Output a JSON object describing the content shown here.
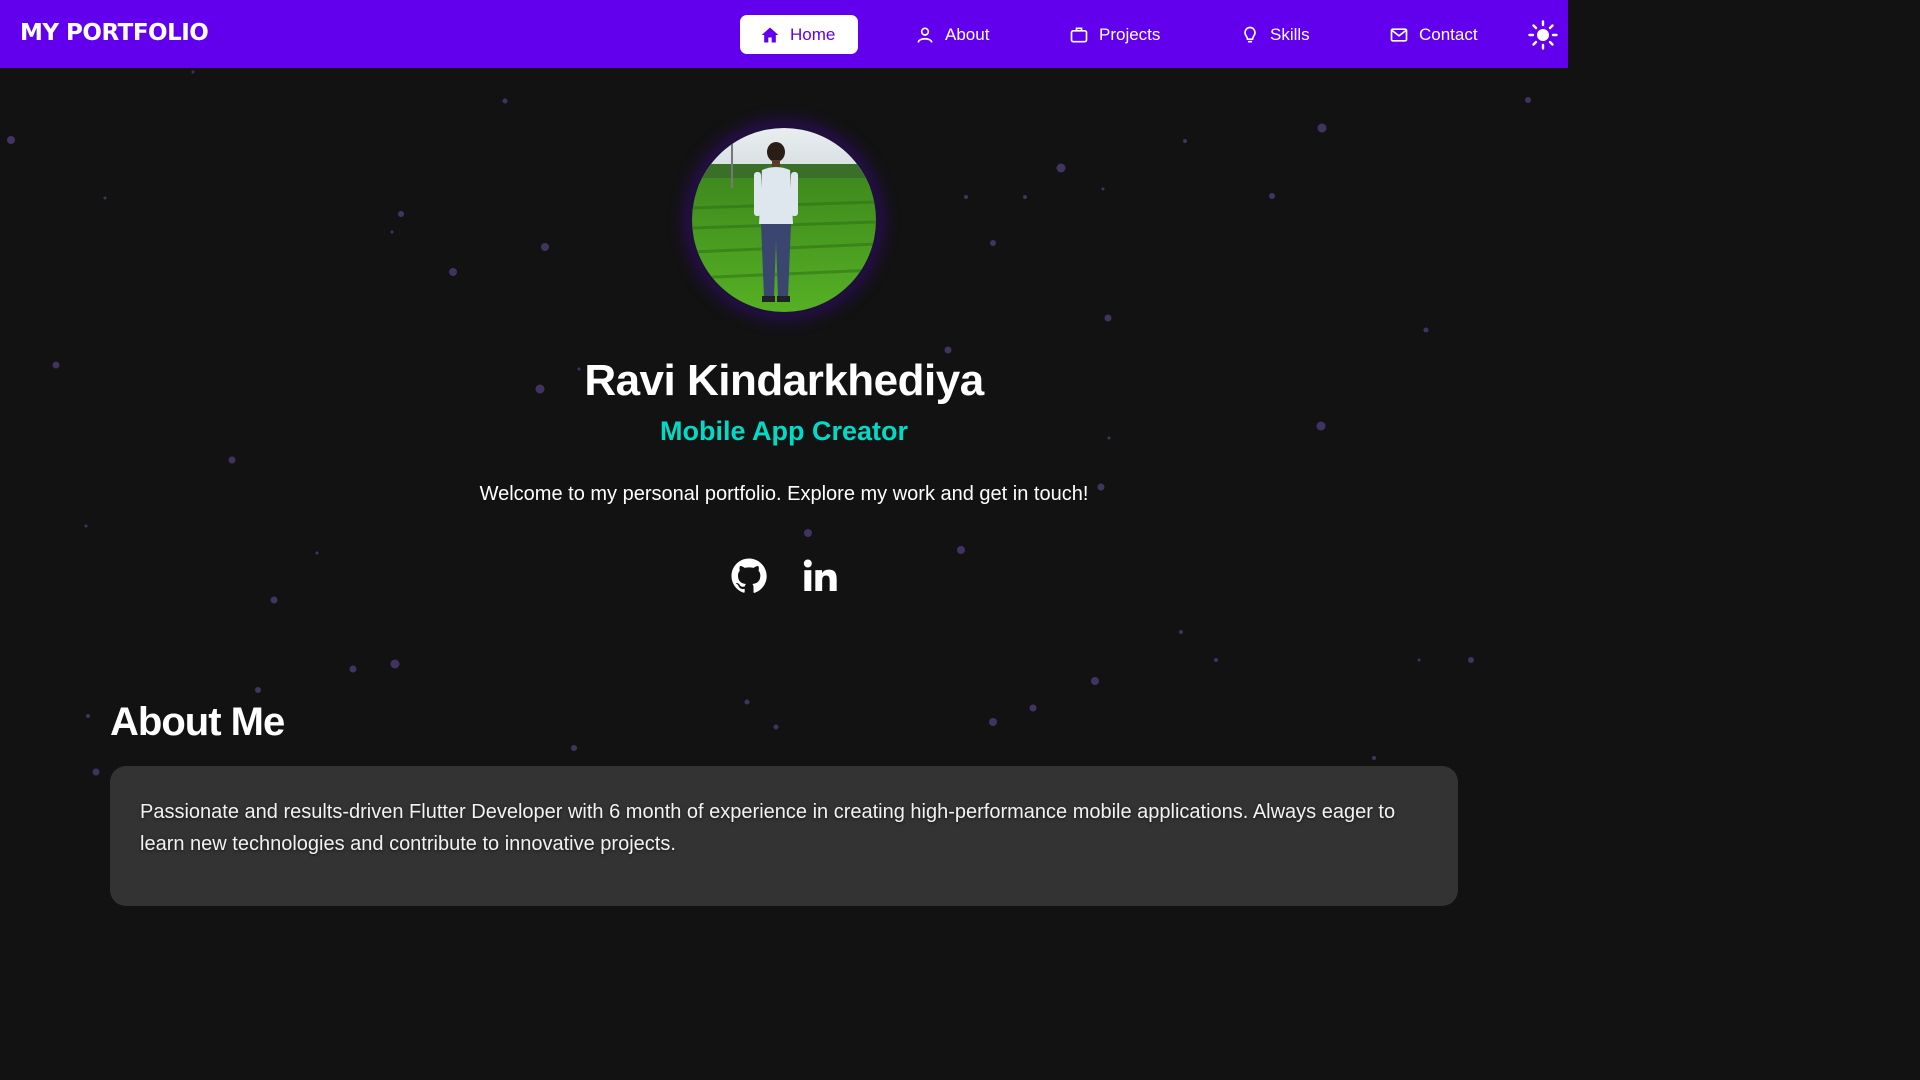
{
  "brand": "MY PORTFOLIO",
  "nav": {
    "home": "Home",
    "about": "About",
    "projects": "Projects",
    "skills": "Skills",
    "contact": "Contact"
  },
  "hero": {
    "name": "Ravi Kindarkhediya",
    "role": "Mobile App Creator",
    "welcome": "Welcome to my personal portfolio. Explore my work and get in touch!"
  },
  "social": [
    "github-icon",
    "linkedin-icon"
  ],
  "about": {
    "heading": "About Me",
    "text": "Passionate and results-driven Flutter Developer with 6 month of experience in creating high-performance mobile applications. Always eager to learn new technologies and contribute to innovative projects."
  },
  "colors": {
    "primary": "#6200ee",
    "accent": "#03dac6",
    "background": "#121212",
    "card": "#333333"
  }
}
